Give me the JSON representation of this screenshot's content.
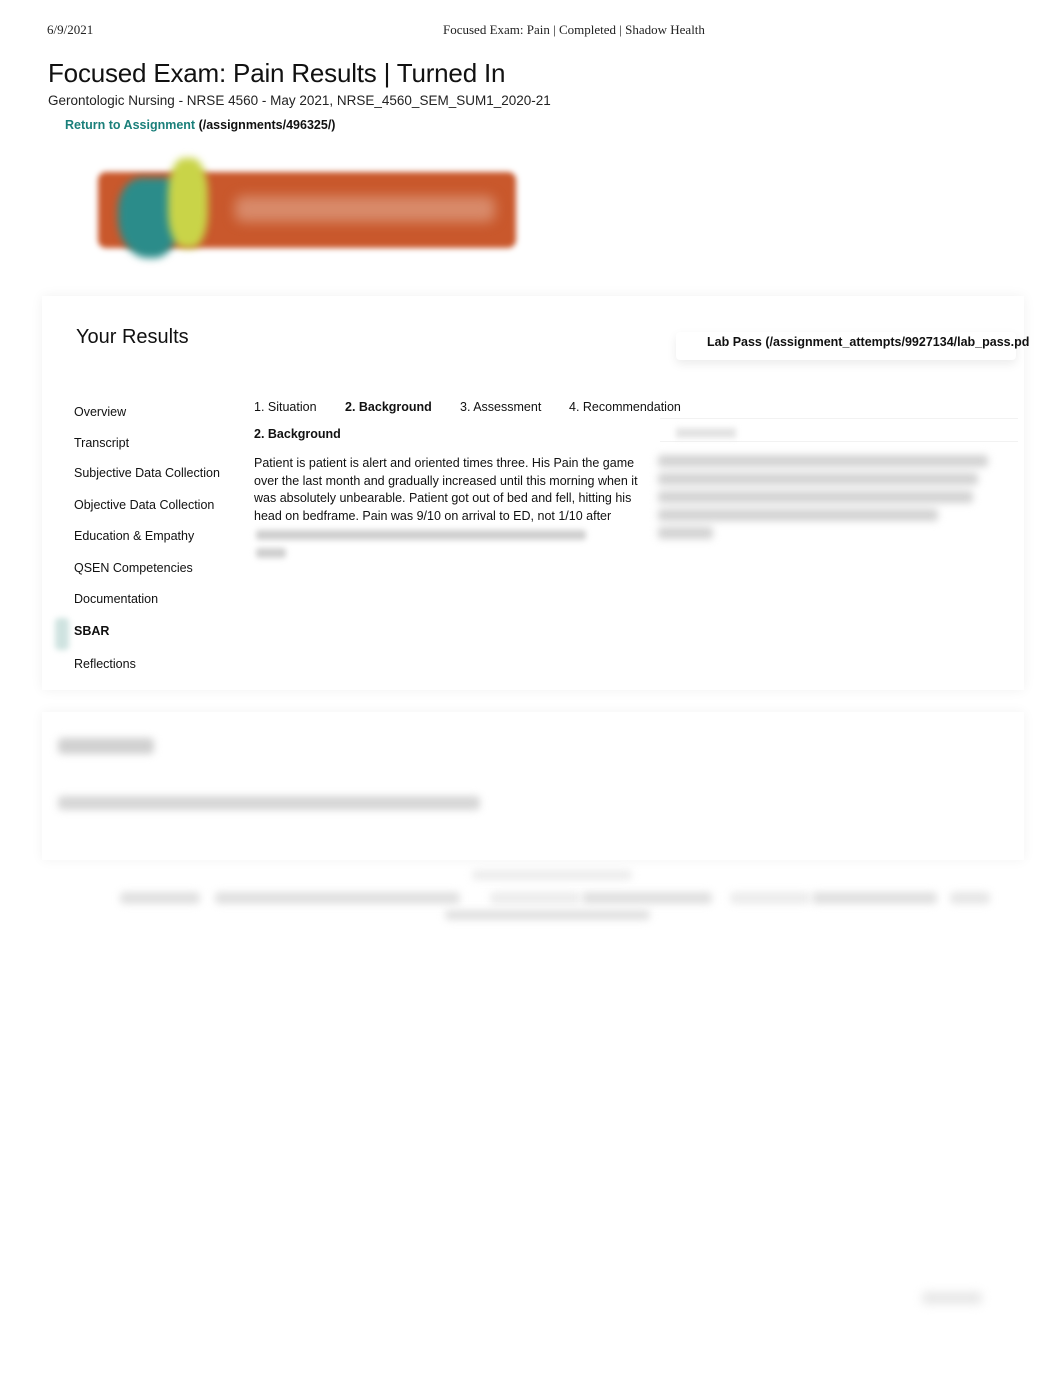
{
  "print_header": {
    "date": "6/9/2021",
    "title": "Focused Exam: Pain | Completed | Shadow Health"
  },
  "page": {
    "title": "Focused Exam: Pain Results | Turned In",
    "course": "Gerontologic Nursing - NRSE 4560 - May 2021, NRSE_4560_SEM_SUM1_2020-21",
    "return_link": {
      "label": "Return to Assignment",
      "path": " (/assignments/496325/)"
    }
  },
  "logo": {
    "name": "Shadow Health",
    "icon": "shadow-health-logo",
    "colors": {
      "background": "#c9582c",
      "teal": "#2b8c8a",
      "lime": "#c9d448"
    }
  },
  "results": {
    "title": "Your Results",
    "lab_pass": "Lab Pass (/assignment_attempts/9927134/lab_pass.pd"
  },
  "sidebar": {
    "items": [
      {
        "label": "Overview",
        "active": false
      },
      {
        "label": "Transcript",
        "active": false
      },
      {
        "label": "Subjective Data Collection",
        "active": false
      },
      {
        "label": "Objective Data Collection",
        "active": false
      },
      {
        "label": "Education & Empathy",
        "active": false
      },
      {
        "label": "QSEN Competencies",
        "active": false
      },
      {
        "label": "Documentation",
        "active": false
      },
      {
        "label": "SBAR",
        "active": true
      },
      {
        "label": "Reflections",
        "active": false
      }
    ]
  },
  "tabs": [
    {
      "label": "1. Situation",
      "active": false
    },
    {
      "label": "2. Background",
      "active": true
    },
    {
      "label": "3. Assessment",
      "active": false
    },
    {
      "label": "4. Recommendation",
      "active": false
    }
  ],
  "section": {
    "heading": "2. Background",
    "body_lines": [
      "Patient is patient is alert and oriented times three. His Pain the game",
      "over the last month and gradually increased until this morning when it",
      "was absolutely unbearable. Patient got out of bed and fell, hitting his",
      "head on bedframe. Pain was 9/10 on arrival to ED, not 1/10 after"
    ]
  },
  "colors": {
    "accent_link": "#1a7f7a",
    "text": "#111111"
  }
}
